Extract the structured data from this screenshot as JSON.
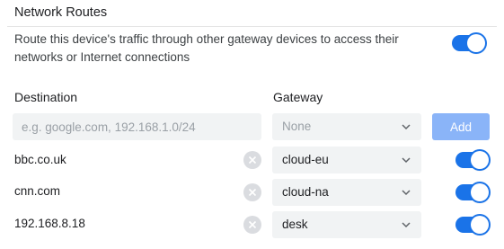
{
  "section": {
    "title": "Network Routes",
    "description": "Route this device's traffic through other gateway devices to access their networks or Internet connections",
    "enabled": true
  },
  "columns": {
    "destination": "Destination",
    "gateway": "Gateway"
  },
  "new_route": {
    "destination_placeholder": "e.g. google.com, 192.168.1.0/24",
    "gateway_placeholder": "None",
    "add_label": "Add"
  },
  "routes": [
    {
      "destination": "bbc.co.uk",
      "gateway": "cloud-eu",
      "enabled": true
    },
    {
      "destination": "cnn.com",
      "gateway": "cloud-na",
      "enabled": true
    },
    {
      "destination": "192.168.8.18",
      "gateway": "desk",
      "enabled": true
    }
  ],
  "icons": {
    "remove": "close-circle-icon",
    "dropdown": "chevron-down-icon"
  },
  "colors": {
    "accent": "#1a73e8",
    "add_button_disabled": "#8ab4f8"
  }
}
